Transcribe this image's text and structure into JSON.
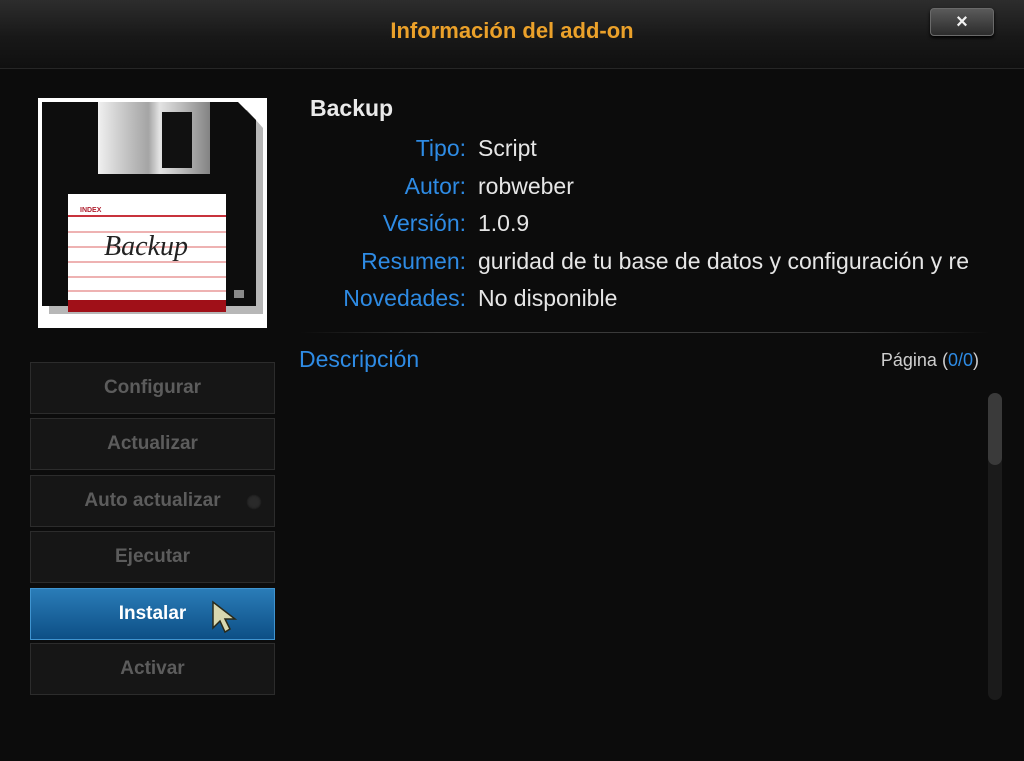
{
  "window": {
    "title": "Información del add-on",
    "close_label": "×"
  },
  "addon": {
    "name": "Backup",
    "thumbnail_text": {
      "index_label": "INDEX",
      "handwritten": "Backup"
    },
    "fields": [
      {
        "label": "Tipo:",
        "value": "Script"
      },
      {
        "label": "Autor:",
        "value": "robweber"
      },
      {
        "label": "Versión:",
        "value": "1.0.9"
      },
      {
        "label": "Resumen:",
        "value": "guridad de tu base de datos y configuración y re"
      },
      {
        "label": "Novedades:",
        "value": "No disponible"
      }
    ]
  },
  "description": {
    "title": "Descripción",
    "page_label": "Página",
    "page_open": "(",
    "page_value": "0/0",
    "page_close": ")"
  },
  "buttons": [
    {
      "label": "Configurar",
      "state": "disabled"
    },
    {
      "label": "Actualizar",
      "state": "disabled"
    },
    {
      "label": "Auto actualizar",
      "state": "disabled",
      "toggle": true
    },
    {
      "label": "Ejecutar",
      "state": "disabled"
    },
    {
      "label": "Instalar",
      "state": "focused"
    },
    {
      "label": "Activar",
      "state": "disabled"
    }
  ],
  "colors": {
    "title": "#eba12a",
    "label": "#2e8be4",
    "button_focus": "#1e6aa6",
    "background": "#0c0c0c"
  },
  "icons": {
    "close": "close-icon",
    "cursor": "pointer-cursor-icon",
    "thumbnail": "floppy-disk-icon"
  }
}
